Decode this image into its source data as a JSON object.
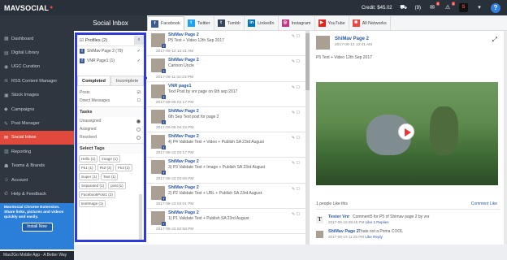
{
  "app": {
    "logo_main": "MAVSOCIAL",
    "credit": "Credit: $45.02",
    "cart_count": "(9)",
    "bell_badge": "0",
    "alert_badge": "0",
    "avatar_letter": "S",
    "help": "?"
  },
  "sidebar": {
    "items": [
      {
        "label": "Dashboard",
        "icon": "dashboard-icon",
        "glyph": "▦"
      },
      {
        "label": "Digital Library",
        "icon": "library-icon",
        "glyph": "▤"
      },
      {
        "label": "UGC Curation",
        "icon": "ugc-icon",
        "glyph": "◉"
      },
      {
        "label": "RSS Content Manager",
        "icon": "rss-icon",
        "glyph": "≋"
      },
      {
        "label": "Stock Images",
        "icon": "image-icon",
        "glyph": "▣"
      },
      {
        "label": "Campaigns",
        "icon": "campaign-icon",
        "glyph": "◆"
      },
      {
        "label": "Post Manager",
        "icon": "edit-icon",
        "glyph": "✎"
      },
      {
        "label": "Social Inbox",
        "icon": "inbox-icon",
        "glyph": "✉",
        "active": true
      },
      {
        "label": "Reporting",
        "icon": "chart-icon",
        "glyph": "▥"
      },
      {
        "label": "Teams & Brands",
        "icon": "team-icon",
        "glyph": "☗"
      },
      {
        "label": "Account",
        "icon": "account-icon",
        "glyph": "☺"
      },
      {
        "label": "Help & Feedback",
        "icon": "help-icon",
        "glyph": "✆"
      },
      {
        "label": "MavChat",
        "icon": "chat-icon",
        "glyph": "◌"
      }
    ],
    "promo_line1": "MavSocial Chrome Extension.",
    "promo_line2": "Share links, pictures and videos quickly and easily.",
    "install_label": "Install Now",
    "footer": "Mav2Go Mobile App - A Better Way"
  },
  "inbox": {
    "title": "Social Inbox",
    "profiles_label": "Profiles (2)",
    "profiles": [
      {
        "name": "ShiMav Page 2 (79)"
      },
      {
        "name": "VNR Page1 (1)"
      }
    ],
    "tabs": [
      "Completed",
      "Incomplete"
    ],
    "filters": [
      "Posts",
      "Direct Messages"
    ],
    "tasks_label": "Tasks",
    "tasks": [
      {
        "label": "Unassigned",
        "selected": true
      },
      {
        "label": "Assigned",
        "selected": false
      },
      {
        "label": "Resolved",
        "selected": false
      }
    ],
    "tags_label": "Select Tags",
    "tags": [
      "Hello (1)",
      "image (1)",
      "Fk1 (1)",
      "Fk2 (3)",
      "Fk3 (2)",
      "Super (1)",
      "Text (1)",
      "Separated (1)",
      "post (1)",
      "FacebookPost1 (2)",
      "textImage (1)"
    ]
  },
  "networks": [
    {
      "label": "Facebook",
      "color": "#3b5998",
      "glyph": "f",
      "icon": "facebook-icon",
      "active": true
    },
    {
      "label": "Twitter",
      "color": "#1da1f2",
      "glyph": "t",
      "icon": "twitter-icon"
    },
    {
      "label": "Tumblr",
      "color": "#35465c",
      "glyph": "t",
      "icon": "tumblr-icon"
    },
    {
      "label": "LinkedIn",
      "color": "#0077b5",
      "glyph": "in",
      "icon": "linkedin-icon"
    },
    {
      "label": "Instagram",
      "color": "#c13584",
      "glyph": "◎",
      "icon": "instagram-icon"
    },
    {
      "label": "YouTube",
      "color": "#e62117",
      "glyph": "▶",
      "icon": "youtube-icon"
    },
    {
      "label": "All Networks",
      "color": "#e8483f",
      "glyph": "✱",
      "icon": "all-networks-icon"
    }
  ],
  "feed": [
    {
      "title": "ShiMav Page 2",
      "text": "P5 Text + Video 12th Sep 2017",
      "date": "2017-09-12 12:41 AM"
    },
    {
      "title": "ShiMav Page 2",
      "text": "Cartoon Uncle",
      "date": "2017-09-11 02:23 PM"
    },
    {
      "title": "VNR page1",
      "text": "Text Post by vnr page on 6th sep 2017",
      "date": "2017-09-06 02:17 PM"
    },
    {
      "title": "ShiMav Page 2",
      "text": "6th Sep Text post for page 2",
      "date": "2017-09-06 04:15 PM"
    },
    {
      "title": "ShiMav Page 2",
      "text": "4) P4 Validate Text + Video + Publish SA 23rd August",
      "date": "2017-08-23 03:17 PM"
    },
    {
      "title": "ShiMav Page 2",
      "text": "3) P3 Validate Text + Image + Publish SA 23rd August",
      "date": "2017-08-23 03:08 PM"
    },
    {
      "title": "ShiMav Page 2",
      "text": "2) P2 Validate Text + URL + Publish SA 23rd August",
      "date": "2017-08-23 03:01 PM"
    },
    {
      "title": "ShiMav Page 2",
      "text": "1) P1 Validate Text + Publish SA 23rd August",
      "date": "2017-08-23 02:58 PM"
    }
  ],
  "detail": {
    "name": "ShiMav Page 2",
    "date": "2017-09-12 12:41 AM",
    "text": "P5 Text + Video 12th Sep 2017",
    "likes": "1 people Like this",
    "comment_link": "Comment",
    "like_link": "Like",
    "comments": [
      {
        "name": "Tester Vnr",
        "body": "Comment5 for P5 of Shimav page 2 by vnr",
        "date": "2017-09-19 08:45 PM",
        "like": "Like",
        "replies": "1 Replies",
        "avatar": "T"
      },
      {
        "name": "ShiMav Page 2",
        "body": "Thats not a Prima COOL",
        "date": "2017-09-19 11:25 PM",
        "like": "Like",
        "replies": "Reply",
        "avatar": ""
      }
    ]
  }
}
